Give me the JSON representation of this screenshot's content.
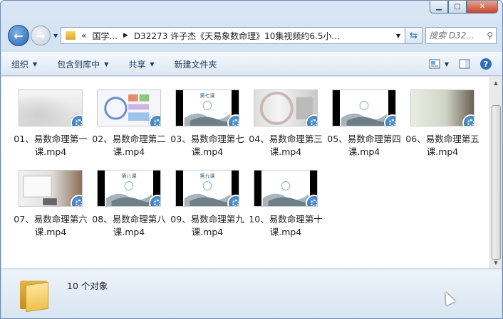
{
  "address": {
    "overflow": "«",
    "segment1": "国学...",
    "segment2": "D32273 许子杰《天易象数命理》10集视频约6.5小..."
  },
  "search": {
    "placeholder": "搜索 D32..."
  },
  "toolbar": {
    "organize": "组织",
    "include_in_library": "包含到库中",
    "share": "共享",
    "new_folder": "新建文件夹",
    "help": "?"
  },
  "files": [
    {
      "name": "01、易数命理第一课.mp4",
      "thumb": "fog"
    },
    {
      "name": "02、易数命理第二课.mp4",
      "thumb": "diagram"
    },
    {
      "name": "03、易数命理第七课.mp4",
      "thumb": "ink",
      "caption": "第七课"
    },
    {
      "name": "04、易数命理第三课.mp4",
      "thumb": "room"
    },
    {
      "name": "05、易数命理第四课.mp4",
      "thumb": "ink",
      "caption": ""
    },
    {
      "name": "06、易数命理第五课.mp4",
      "thumb": "room2"
    },
    {
      "name": "07、易数命理第六课.mp4",
      "thumb": "room3"
    },
    {
      "name": "08、易数命理第八课.mp4",
      "thumb": "ink",
      "caption": "第八课"
    },
    {
      "name": "09、易数命理第九课.mp4",
      "thumb": "ink",
      "caption": "第九课"
    },
    {
      "name": "10、易数命理第十课.mp4",
      "thumb": "ink",
      "caption": ""
    }
  ],
  "status": {
    "count_text": "10 个对象"
  },
  "colors": {
    "accent": "#2d6fb9",
    "badge": "#1b5597"
  }
}
